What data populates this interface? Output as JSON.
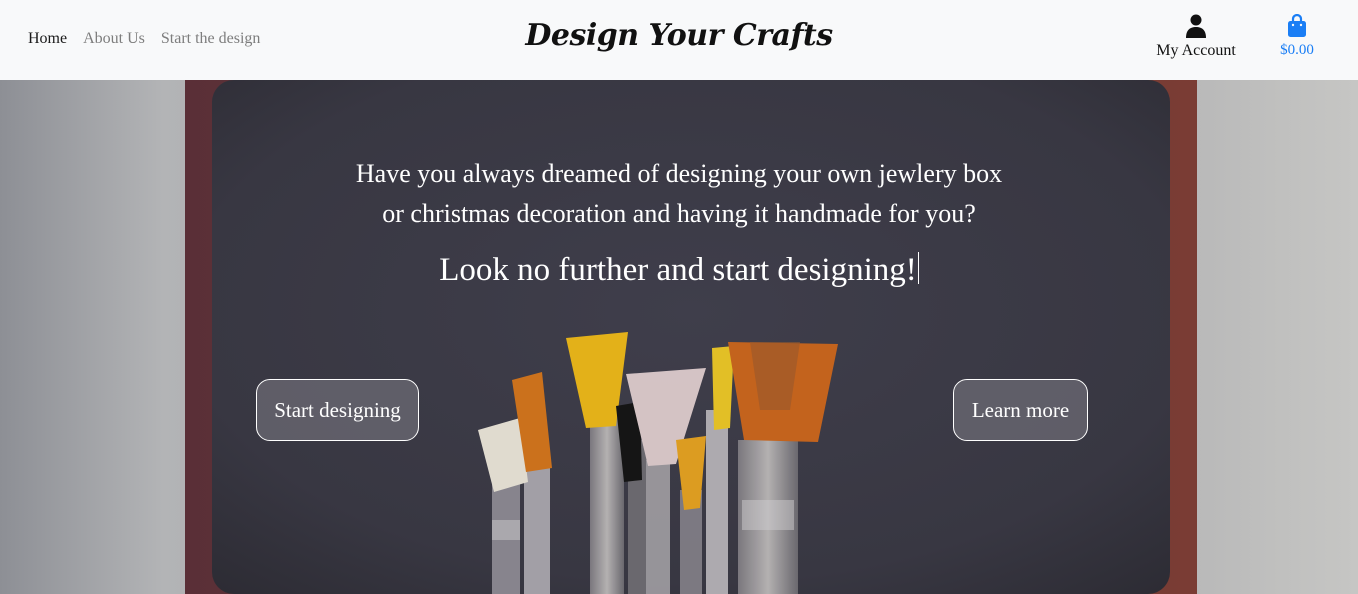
{
  "nav": {
    "links": [
      {
        "label": "Home",
        "active": true
      },
      {
        "label": "About Us",
        "active": false
      },
      {
        "label": "Start the design",
        "active": false
      }
    ],
    "brand": "Design Your Crafts",
    "account_icon": "user-icon",
    "account_label": "My Account",
    "cart_icon": "shopping-bag-icon",
    "cart_total": "$0.00",
    "cart_color": "#1a7ef5"
  },
  "hero": {
    "background": "paintbrushes-in-jar-photo",
    "line1": "Have you always dreamed of designing your own jewlery box",
    "line2": "or christmas decoration and having it handmade for you?",
    "tagline": "Look no further and start designing!",
    "primary_button": "Start designing",
    "secondary_button": "Learn more"
  }
}
